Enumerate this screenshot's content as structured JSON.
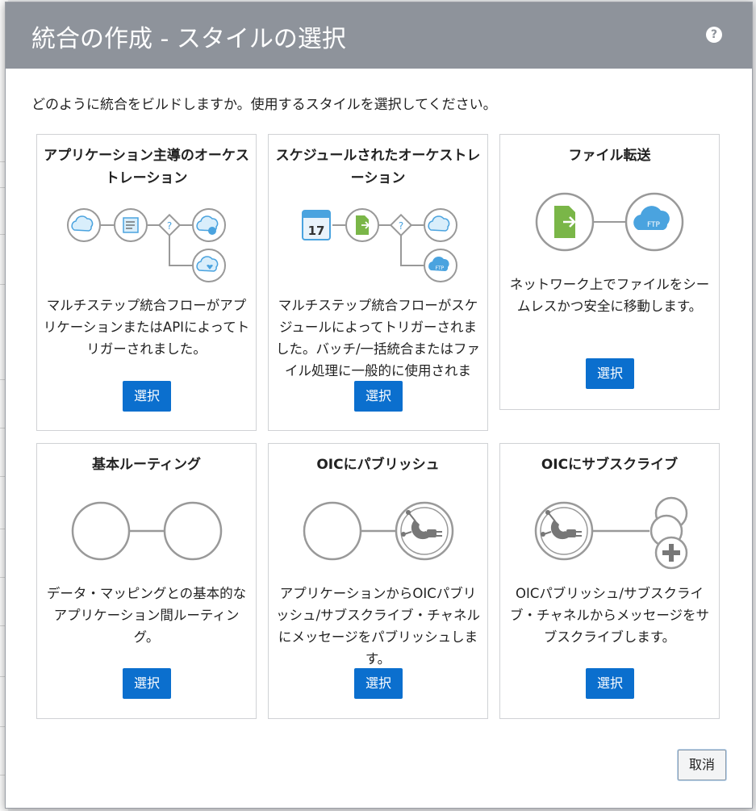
{
  "dialog": {
    "title": "統合の作成 - スタイルの選択",
    "help_symbol": "?",
    "subtitle": "どのように統合をビルドしますか。使用するスタイルを選択してください。",
    "cancel_label": "取消"
  },
  "cards": [
    {
      "title": "アプリケーション主導のオーケストレーション",
      "description": "マルチステップ統合フローがアプリケーションまたはAPIによってトリガーされました。",
      "button_label": "選択",
      "icons": [
        "cloud-icon",
        "mapper-icon",
        "decision-icon",
        "cloud-dollar-icon",
        "cloud-heart-icon"
      ]
    },
    {
      "title": "スケジュールされたオーケストレーション",
      "description": "マルチステップ統合フローがスケジュールによってトリガーされました。バッチ/一括統合またはファイル処理に一般的に使用されます。",
      "button_label": "選択",
      "calendar_day": "17",
      "icons": [
        "calendar-icon",
        "file-arrow-icon",
        "decision-icon",
        "cloud-icon",
        "cloud-ftp-icon"
      ]
    },
    {
      "title": "ファイル転送",
      "description": "ネットワーク上でファイルをシームレスかつ安全に移動します。",
      "button_label": "選択",
      "ftp_label": "FTP",
      "icons": [
        "file-arrow-icon",
        "cloud-ftp-icon"
      ]
    },
    {
      "title": "基本ルーティング",
      "description": "データ・マッピングとの基本的なアプリケーション間ルーティング。",
      "button_label": "選択",
      "icons": [
        "empty-node-icon",
        "empty-node-icon"
      ]
    },
    {
      "title": "OICにパブリッシュ",
      "description": "アプリケーションからOICパブリッシュ/サブスクライブ・チャネルにメッセージをパブリッシュします。",
      "button_label": "選択",
      "icons": [
        "empty-node-icon",
        "publish-plug-icon"
      ]
    },
    {
      "title": "OICにサブスクライブ",
      "description": "OICパブリッシュ/サブスクライブ・チャネルからメッセージをサブスクライブします。",
      "button_label": "選択",
      "icons": [
        "publish-plug-icon",
        "empty-node-icon",
        "add-node-icon"
      ]
    }
  ],
  "colors": {
    "header": "#8e939b",
    "primary_button": "#0b6fce",
    "cloud_blue": "#4aa3df",
    "file_green": "#7ab648",
    "node_border": "#9a9a9a"
  }
}
